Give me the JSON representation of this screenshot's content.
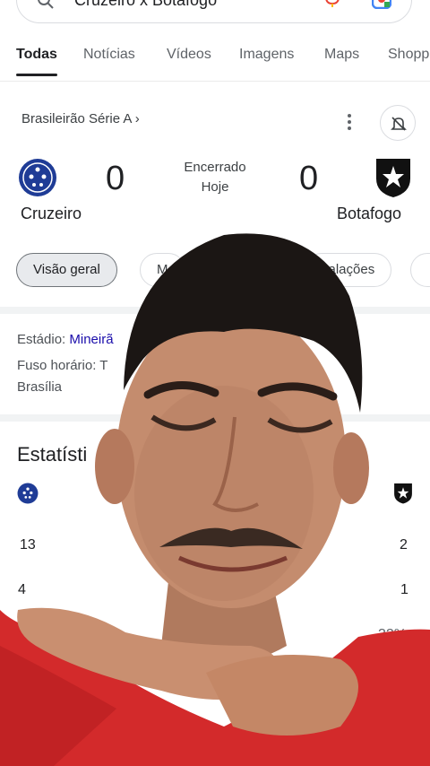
{
  "search": {
    "query": "Cruzeiro x Botafogo"
  },
  "tabs": [
    {
      "label": "Todas"
    },
    {
      "label": "Notícias"
    },
    {
      "label": "Vídeos"
    },
    {
      "label": "Imagens"
    },
    {
      "label": "Maps"
    },
    {
      "label": "Shopp"
    }
  ],
  "match": {
    "league": "Brasileirão Série A ›",
    "home": {
      "name": "Cruzeiro",
      "score": "0"
    },
    "away": {
      "name": "Botafogo",
      "score": "0"
    },
    "status": "Encerrado",
    "date": "Hoje"
  },
  "chips": [
    {
      "label": "Visão geral"
    },
    {
      "label": "M"
    },
    {
      "label": "calações"
    }
  ],
  "info": {
    "stadium_label": "Estádio:",
    "stadium_value": "Mineirã",
    "tz_label": "Fuso horário:",
    "tz_value": "T",
    "tz_city": "Brasília"
  },
  "stats": {
    "title": "Estatísti",
    "rows": [
      {
        "home": "13",
        "away": "2"
      },
      {
        "home": "4",
        "away": "1"
      },
      {
        "home": "",
        "away": "32%"
      }
    ]
  },
  "colors": {
    "accent": "#1a73e8",
    "link": "#1a0dab",
    "shirt": "#d21f26"
  }
}
